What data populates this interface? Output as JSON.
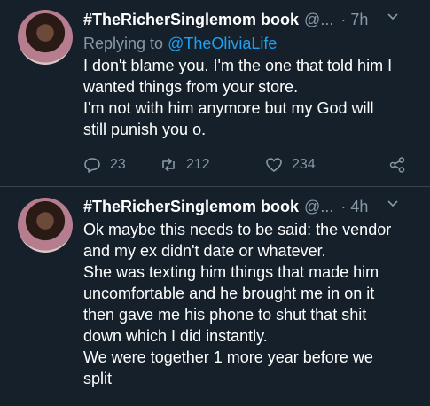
{
  "tweets": [
    {
      "name": "#TheRicherSinglemom book",
      "handle": "@...",
      "time": "· 7h",
      "replying_prefix": "Replying to ",
      "replying_to": "@TheOliviaLife",
      "lines": [
        "I don't blame you. I'm the one that told him I",
        "wanted things from your store.",
        "I'm not with him anymore but my God will",
        "still punish you o."
      ],
      "replies": "23",
      "retweets": "212",
      "likes": "234"
    },
    {
      "name": "#TheRicherSinglemom book",
      "handle": "@...",
      "time": "· 4h",
      "lines": [
        "Ok maybe this needs to be said: the vendor",
        "and my ex didn't date or whatever.",
        "She was texting him things that made him",
        "uncomfortable and he brought me in on it",
        "then gave me his phone to shut that shit",
        "down which I did instantly.",
        "We were together 1 more year before we",
        "split"
      ]
    }
  ],
  "icons": {
    "reply": "reply-icon",
    "retweet": "retweet-icon",
    "like": "like-icon",
    "share": "share-icon",
    "chevron": "chevron-down-icon"
  },
  "colors": {
    "background": "#15202b",
    "secondary_text": "#8899a6",
    "link": "#1da1f2"
  }
}
